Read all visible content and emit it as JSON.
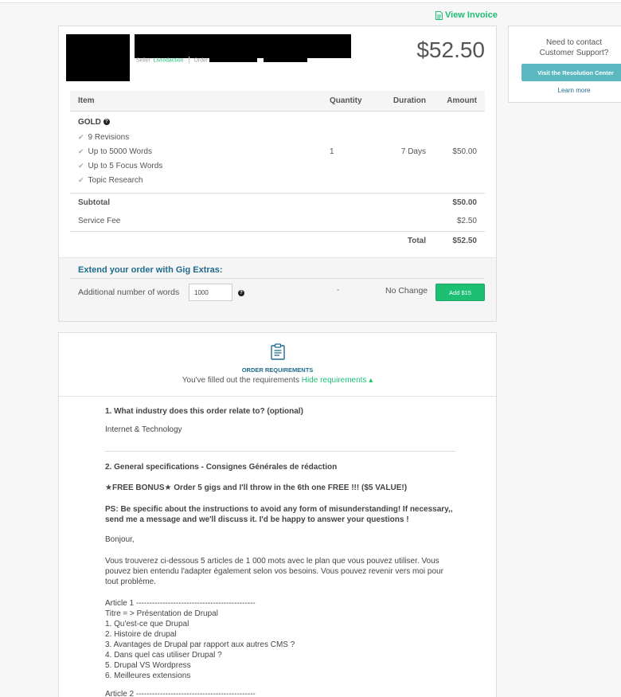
{
  "header": {
    "view_invoice_label": "View Invoice"
  },
  "order": {
    "price": "$52.50",
    "seller_prefix": "Seller:",
    "seller_name": "Livredaction",
    "order_prefix": "Order"
  },
  "items_table": {
    "columns": [
      "Item",
      "Quantity",
      "Duration",
      "Amount"
    ],
    "package_name": "GOLD",
    "features": [
      "9 Revisions",
      "Up to 5000 Words",
      "Up to 5 Focus Words",
      "Topic Research"
    ],
    "quantity": "1",
    "duration": "7 Days",
    "amount": "$50.00",
    "subtotal_label": "Subtotal",
    "subtotal_value": "$50.00",
    "fee_label": "Service Fee",
    "fee_value": "$2.50",
    "total_label": "Total",
    "total_value": "$52.50"
  },
  "extras": {
    "title": "Extend your order with Gig Extras:",
    "label": "Additional number of words",
    "input_value": "1000",
    "dash": "-",
    "status": "No Change",
    "add_button": "Add $15"
  },
  "support": {
    "text_line1": "Need to contact",
    "text_line2": "Customer Support?",
    "button": "Visit the Resolution Center",
    "learn_more": "Learn more"
  },
  "requirements": {
    "title": "ORDER REQUIREMENTS",
    "subtitle": "You've filled out the requirements",
    "hide_link": "Hide requirements ▴",
    "q1": "1. What industry does this order relate to? (optional)",
    "a1": "Internet & Technology",
    "q2": "2. General specifications - Consignes Générales de rédaction",
    "bonus": "★FREE BONUS★ Order 5 gigs and I'll throw in the 6th one FREE !!! ($5 VALUE!)",
    "ps": "PS: Be specific about the instructions to avoid any form of misunderstanding! If necessary,, send me a message and we'll discuss it. I'd be happy to answer your questions !",
    "bonjour": "Bonjour,",
    "intro": "Vous trouverez ci-dessous 5 articles de 1 000 mots avec le plan que vous pouvez utiliser. Vous pouvez bien entendu l'adapter également selon vos besoins. Vous pouvez revenir vers moi pour tout problème.",
    "article1_lines": [
      "Article 1 ---------------------------------------------",
      "Titre = > Présentation de Drupal",
      "1. Qu'est-ce que Drupal",
      "2. Histoire de drupal",
      "3. Avantages de Drupal par rapport aux autres CMS ?",
      "4. Dans quel cas utiliser Drupal ?",
      "5. Drupal VS Wordpress",
      "6. Meilleures extensions"
    ],
    "article2_line": "Article 2 ---------------------------------------------"
  }
}
